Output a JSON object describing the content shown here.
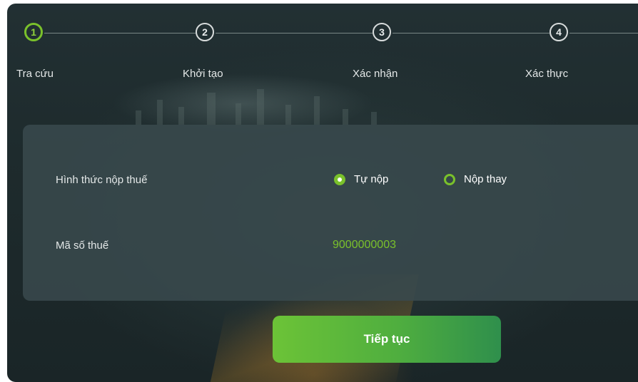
{
  "steps": [
    {
      "number": "1",
      "label": "Tra cứu",
      "active": true
    },
    {
      "number": "2",
      "label": "Khởi tạo",
      "active": false
    },
    {
      "number": "3",
      "label": "Xác nhận",
      "active": false
    },
    {
      "number": "4",
      "label": "Xác thực",
      "active": false
    }
  ],
  "form": {
    "payment_method_label": "Hình thức nộp thuế",
    "options": [
      {
        "label": "Tự nộp",
        "selected": true
      },
      {
        "label": "Nộp thay",
        "selected": false
      }
    ],
    "tax_code_label": "Mã số thuế",
    "tax_code_value": "9000000003"
  },
  "continue_button": "Tiếp tục",
  "colors": {
    "accent": "#7ac12b",
    "background": "#1e2b2d"
  }
}
